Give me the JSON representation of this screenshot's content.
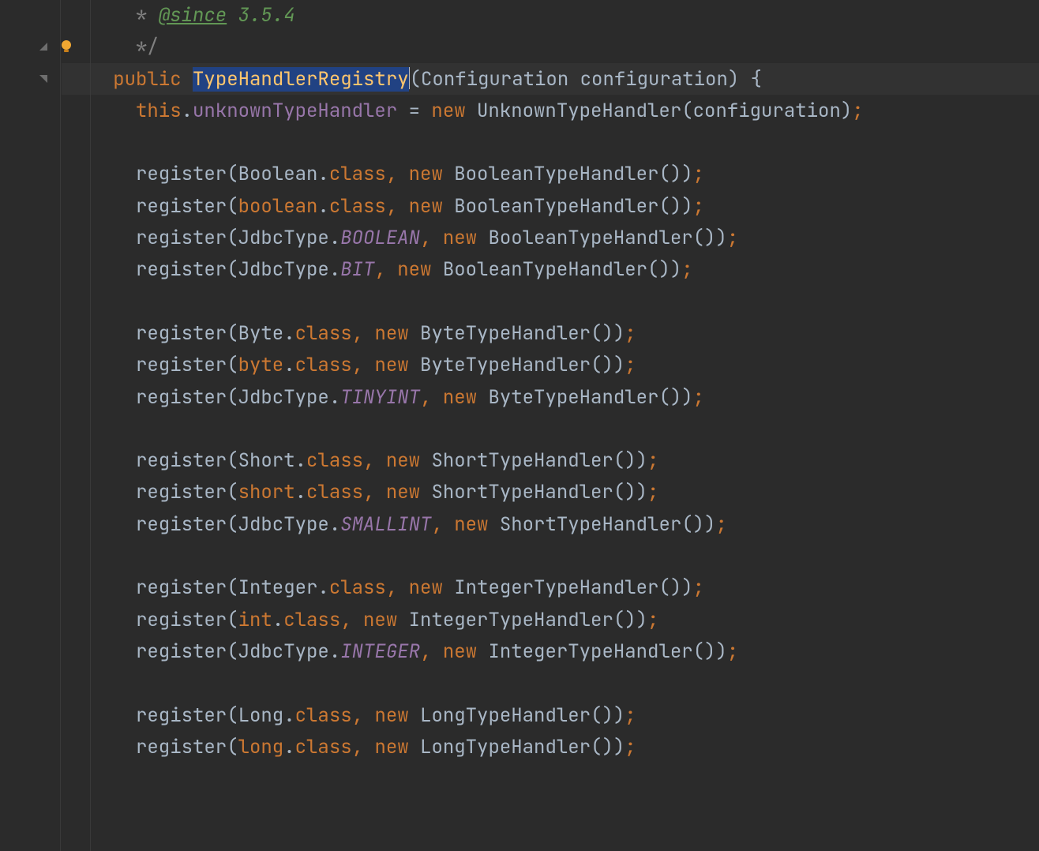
{
  "colors": {
    "bg": "#2b2b2b",
    "line_hl": "#323232",
    "selection": "#214283"
  },
  "doc": {
    "since_tag": "@since",
    "since_ver": "3.5.4",
    "close": "*/"
  },
  "gutter": {
    "bulb": "bulb-icon",
    "fold_end": "fold-end-icon",
    "fold_start": "fold-start-icon"
  },
  "sig": {
    "kw_public": "public",
    "selected_name": "TypeHandlerRegistry",
    "param_type": "Configuration",
    "param_name": "configuration",
    "lbrace": "{"
  },
  "body_line": {
    "this": "this",
    "dot": ".",
    "field": "unknownTypeHandler",
    "eq": " = ",
    "new": "new",
    "ctor": "UnknownTypeHandler",
    "arg": "configuration"
  },
  "common": {
    "register": "register",
    "new": "new",
    "class": "class",
    "JdbcType": "JdbcType"
  },
  "lines": [
    {
      "k": "doc_since"
    },
    {
      "k": "doc_close"
    },
    {
      "k": "sig"
    },
    {
      "k": "assign"
    },
    {
      "k": "blank"
    },
    {
      "k": "regc",
      "target": "Boolean",
      "handler": "BooleanTypeHandler"
    },
    {
      "k": "regc",
      "target": "boolean",
      "kw": true,
      "handler": "BooleanTypeHandler"
    },
    {
      "k": "regj",
      "enum": "BOOLEAN",
      "handler": "BooleanTypeHandler"
    },
    {
      "k": "regj",
      "enum": "BIT",
      "handler": "BooleanTypeHandler"
    },
    {
      "k": "blank"
    },
    {
      "k": "regc",
      "target": "Byte",
      "handler": "ByteTypeHandler"
    },
    {
      "k": "regc",
      "target": "byte",
      "kw": true,
      "handler": "ByteTypeHandler"
    },
    {
      "k": "regj",
      "enum": "TINYINT",
      "handler": "ByteTypeHandler"
    },
    {
      "k": "blank"
    },
    {
      "k": "regc",
      "target": "Short",
      "handler": "ShortTypeHandler"
    },
    {
      "k": "regc",
      "target": "short",
      "kw": true,
      "handler": "ShortTypeHandler"
    },
    {
      "k": "regj",
      "enum": "SMALLINT",
      "handler": "ShortTypeHandler"
    },
    {
      "k": "blank"
    },
    {
      "k": "regc",
      "target": "Integer",
      "handler": "IntegerTypeHandler"
    },
    {
      "k": "regc",
      "target": "int",
      "kw": true,
      "handler": "IntegerTypeHandler"
    },
    {
      "k": "regj",
      "enum": "INTEGER",
      "handler": "IntegerTypeHandler"
    },
    {
      "k": "blank"
    },
    {
      "k": "regc",
      "target": "Long",
      "handler": "LongTypeHandler"
    },
    {
      "k": "regc",
      "target": "long",
      "kw": true,
      "handler": "LongTypeHandler"
    },
    {
      "k": "blank"
    }
  ]
}
